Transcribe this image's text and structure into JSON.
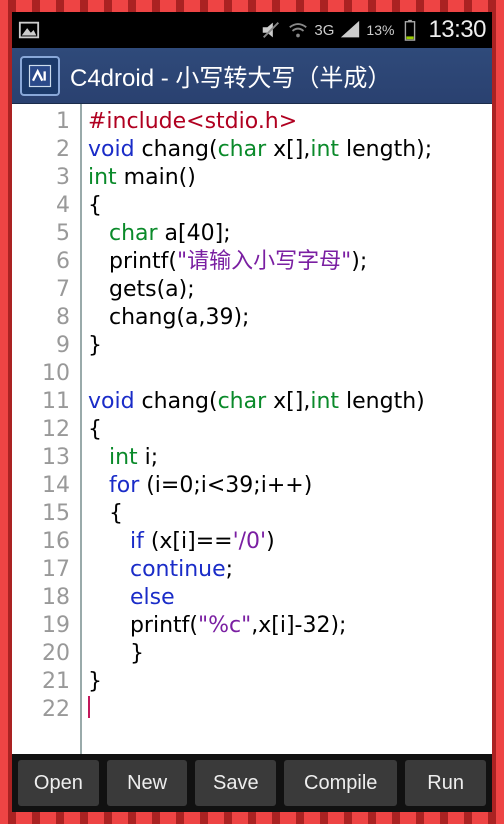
{
  "status": {
    "network_label": "3G",
    "battery_pct": "13%",
    "time": "13:30"
  },
  "titlebar": {
    "title": "C4droid - 小写转大写（半成）"
  },
  "editor": {
    "lines": [
      {
        "n": 1,
        "tokens": [
          {
            "t": "#include<stdio.h>",
            "c": "pre"
          }
        ]
      },
      {
        "n": 2,
        "tokens": [
          {
            "t": "void",
            "c": "kw"
          },
          {
            "t": " chang("
          },
          {
            "t": "char",
            "c": "typ"
          },
          {
            "t": " x[],"
          },
          {
            "t": "int",
            "c": "typ"
          },
          {
            "t": " length);"
          }
        ]
      },
      {
        "n": 3,
        "tokens": [
          {
            "t": "int",
            "c": "typ"
          },
          {
            "t": " main()"
          }
        ]
      },
      {
        "n": 4,
        "tokens": [
          {
            "t": "{"
          }
        ]
      },
      {
        "n": 5,
        "tokens": [
          {
            "t": "   "
          },
          {
            "t": "char",
            "c": "typ"
          },
          {
            "t": " a[40];"
          }
        ]
      },
      {
        "n": 6,
        "tokens": [
          {
            "t": "   printf("
          },
          {
            "t": "\"请输入小写字母\"",
            "c": "str"
          },
          {
            "t": ");"
          }
        ]
      },
      {
        "n": 7,
        "tokens": [
          {
            "t": "   gets(a);"
          }
        ]
      },
      {
        "n": 8,
        "tokens": [
          {
            "t": "   chang(a,39);"
          }
        ]
      },
      {
        "n": 9,
        "tokens": [
          {
            "t": "}"
          }
        ]
      },
      {
        "n": 10,
        "tokens": [
          {
            "t": ""
          }
        ]
      },
      {
        "n": 11,
        "tokens": [
          {
            "t": "void",
            "c": "kw"
          },
          {
            "t": " chang("
          },
          {
            "t": "char",
            "c": "typ"
          },
          {
            "t": " x[],"
          },
          {
            "t": "int",
            "c": "typ"
          },
          {
            "t": " length)"
          }
        ]
      },
      {
        "n": 12,
        "tokens": [
          {
            "t": "{"
          }
        ]
      },
      {
        "n": 13,
        "tokens": [
          {
            "t": "   "
          },
          {
            "t": "int",
            "c": "typ"
          },
          {
            "t": " i;"
          }
        ]
      },
      {
        "n": 14,
        "tokens": [
          {
            "t": "   "
          },
          {
            "t": "for",
            "c": "kw"
          },
          {
            "t": " (i=0;i<39;i++)"
          }
        ]
      },
      {
        "n": 15,
        "tokens": [
          {
            "t": "   {"
          }
        ]
      },
      {
        "n": 16,
        "tokens": [
          {
            "t": "      "
          },
          {
            "t": "if",
            "c": "kw"
          },
          {
            "t": " (x[i]=="
          },
          {
            "t": "'/0'",
            "c": "str"
          },
          {
            "t": ")"
          }
        ]
      },
      {
        "n": 17,
        "tokens": [
          {
            "t": "      "
          },
          {
            "t": "continue",
            "c": "kw"
          },
          {
            "t": ";"
          }
        ]
      },
      {
        "n": 18,
        "tokens": [
          {
            "t": "      "
          },
          {
            "t": "else",
            "c": "kw"
          }
        ]
      },
      {
        "n": 19,
        "tokens": [
          {
            "t": "      printf("
          },
          {
            "t": "\"%c\"",
            "c": "str"
          },
          {
            "t": ",x[i]-32);"
          }
        ]
      },
      {
        "n": 20,
        "tokens": [
          {
            "t": "      }"
          }
        ]
      },
      {
        "n": 21,
        "tokens": [
          {
            "t": "}"
          }
        ]
      },
      {
        "n": 22,
        "tokens": [
          {
            "t": "",
            "cursor": true
          }
        ]
      }
    ]
  },
  "buttons": {
    "open": "Open",
    "new": "New",
    "save": "Save",
    "compile": "Compile",
    "run": "Run"
  }
}
